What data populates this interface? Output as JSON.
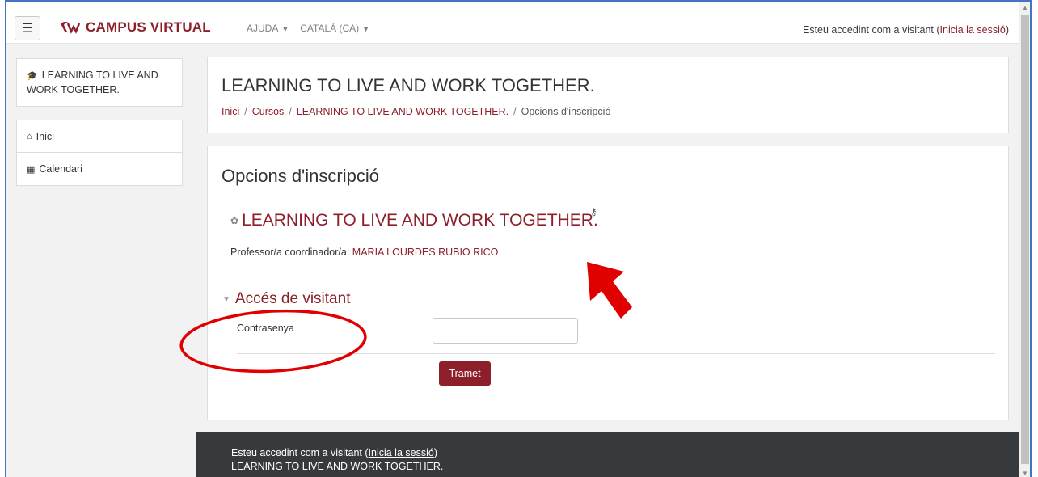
{
  "navbar": {
    "menu_icon": "hamburger-icon",
    "brand": "CAMPUS VIRTUAL",
    "help_menu": "AJUDA",
    "language_menu": "CATALÀ (CA)",
    "login_text": "Esteu accedint com a visitant (",
    "login_link": "Inicia la sessió",
    "login_close": ")"
  },
  "sidebar": {
    "course_icon": "graduation-cap-icon",
    "course_name": "LEARNING TO LIVE AND WORK TOGETHER.",
    "items": [
      {
        "icon": "home-icon",
        "label": "Inici"
      },
      {
        "icon": "calendar-icon",
        "label": "Calendari"
      }
    ]
  },
  "header": {
    "title": "LEARNING TO LIVE AND WORK TOGETHER.",
    "breadcrumb": [
      {
        "label": "Inici"
      },
      {
        "label": "Cursos"
      },
      {
        "label": "LEARNING TO LIVE AND WORK TOGETHER."
      },
      {
        "label": "Opcions d'inscripció"
      }
    ]
  },
  "main": {
    "section_title": "Opcions d'inscripció",
    "course_title": "LEARNING TO LIVE AND WORK TOGETHER.",
    "teacher_label": "Professor/a coordinador/a:",
    "teacher_name": "MARIA LOURDES RUBIO RICO",
    "guest_access_legend": "Accés de visitant",
    "password_label": "Contrasenya",
    "password_value": "",
    "submit_label": "Tramet"
  },
  "footer": {
    "login_text": "Esteu accedint com a visitant (",
    "login_link": "Inicia la sessió",
    "login_close": ")",
    "course_link": "LEARNING TO LIVE AND WORK TOGETHER."
  },
  "colors": {
    "brand": "#8c1f2a",
    "footer_bg": "#373a3c",
    "annotation": "#e00000"
  }
}
